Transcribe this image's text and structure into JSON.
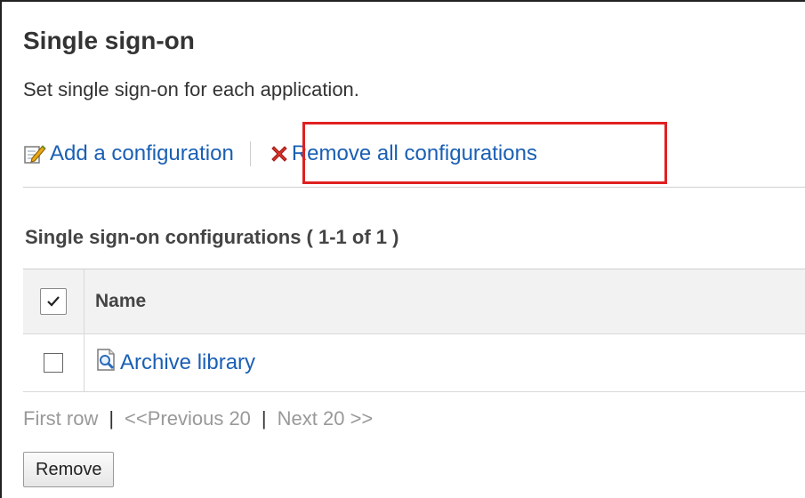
{
  "page": {
    "title": "Single sign-on",
    "description": "Set single sign-on for each application."
  },
  "actions": {
    "add_label": "Add a configuration",
    "remove_all_label": "Remove all configurations",
    "add_icon": "edit-pencil-icon",
    "remove_all_icon": "red-x-icon"
  },
  "list": {
    "title": "Single sign-on configurations ( 1-1 of 1 )",
    "columns": [
      "Name"
    ],
    "rows": [
      {
        "name": "Archive library",
        "icon": "app-search-icon",
        "checked": false
      }
    ]
  },
  "pager": {
    "first": "First row",
    "previous": "<<Previous 20",
    "next": "Next 20 >>",
    "separator": "|"
  },
  "buttons": {
    "remove": "Remove"
  },
  "colors": {
    "link": "#1a5fb4",
    "highlight": "#e02020",
    "muted": "#999999"
  }
}
